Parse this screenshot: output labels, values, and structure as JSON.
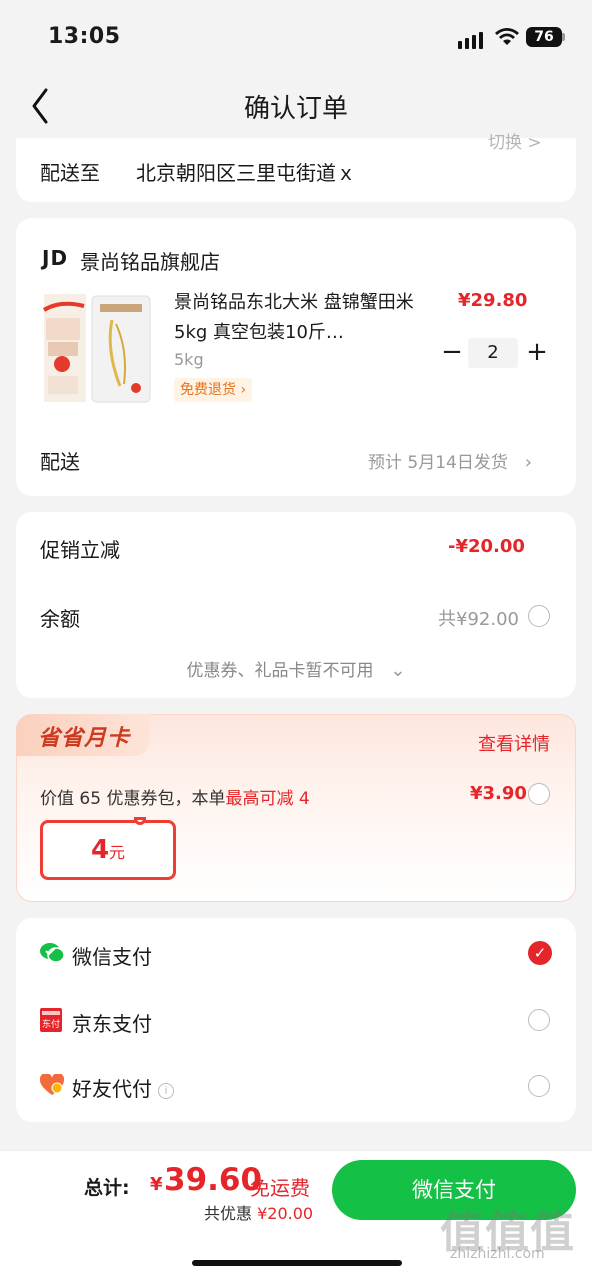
{
  "status_bar": {
    "time": "13:05",
    "battery": "76"
  },
  "nav": {
    "title": "确认订单"
  },
  "address": {
    "switch_label": "切换 >",
    "label": "配送至",
    "value": "北京朝阳区三里屯街道ｘ"
  },
  "store": {
    "brand": "JD",
    "name": "景尚铭品旗舰店",
    "product": {
      "name": "景尚铭品东北大米 盘锦蟹田米5kg  真空包装10斤…",
      "spec": "5kg",
      "return_tag": "免费退货",
      "price": "¥29.80",
      "quantity": "2"
    },
    "shipping": {
      "label": "配送",
      "value": "预计 5月14日发货"
    }
  },
  "promo": {
    "discount_label": "促销立减",
    "discount_value": "-¥20.00",
    "balance_label": "余额",
    "balance_value": "共¥92.00",
    "coupon_note": "优惠券、礼品卡暂不可用"
  },
  "monthly_card": {
    "tag": "省省月卡",
    "detail_link": "查看详情",
    "desc_prefix": "价值 65 优惠券包，本单",
    "desc_highlight": "最高可减 4",
    "price": "¥3.90",
    "ticket_amount": "4",
    "ticket_unit": "元"
  },
  "payment": {
    "options": [
      {
        "label": "微信支付",
        "icon": "wechat-pay-icon",
        "selected": true
      },
      {
        "label": "京东支付",
        "icon": "jd-pay-icon",
        "selected": false
      },
      {
        "label": "好友代付",
        "icon": "friend-pay-icon",
        "selected": false
      }
    ]
  },
  "footer": {
    "total_label": "总计:",
    "currency": "¥",
    "total_amount": "39.60",
    "free_shipping": "免运费",
    "saved_label": "共优惠",
    "saved_amount": "¥20.00",
    "pay_button": "微信支付"
  },
  "watermark": {
    "main": "值值值",
    "sub": "zhizhizhi.com"
  },
  "colors": {
    "accent": "#e4262a",
    "pay_green": "#14c046",
    "background": "#f3f3f3"
  }
}
